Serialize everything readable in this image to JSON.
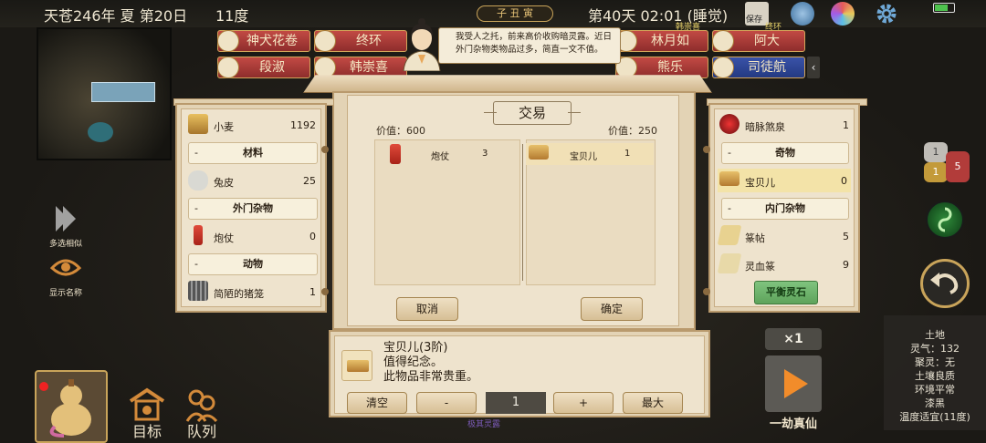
{
  "topbar": {
    "date": "天苍246年 夏 第20日",
    "temperature": "11度",
    "clock_badge": "子 丑 寅",
    "day_time": "第40天 02:01 (睡觉)",
    "save_label": "保存",
    "battery_level": 0.6
  },
  "npcs": [
    {
      "name": "神犬花卷",
      "style": "red"
    },
    {
      "name": "终环",
      "style": "red"
    },
    {
      "name": "段淑",
      "style": "red"
    },
    {
      "name": "韩崇喜",
      "style": "red"
    },
    {
      "name": "林月如",
      "style": "red"
    },
    {
      "name": "阿大",
      "style": "red"
    },
    {
      "name": "熊乐",
      "style": "red"
    },
    {
      "name": "司徒航",
      "style": "blue"
    }
  ],
  "npc_small_labels": [
    "韩崇喜",
    "终环"
  ],
  "speech": "我受人之托，前来高价收购暗灵露。近日外门杂物类物品过多，简直一文不值。",
  "trade": {
    "title": "交易",
    "left_price": "价值：600",
    "right_price": "价值：250",
    "left_items": [
      {
        "name": "炮仗",
        "count": "3"
      }
    ],
    "right_items": [
      {
        "name": "宝贝儿",
        "count": "1"
      }
    ],
    "cancel_label": "取消",
    "confirm_label": "确定"
  },
  "player_inventory": {
    "rows": [
      {
        "type": "item",
        "name": "小麦",
        "count": "1192",
        "icon": "wheat-icon"
      },
      {
        "type": "category",
        "name": "材料"
      },
      {
        "type": "item",
        "name": "兔皮",
        "count": "25",
        "icon": "rabbit-fur-icon"
      },
      {
        "type": "category",
        "name": "外门杂物"
      },
      {
        "type": "item",
        "name": "炮仗",
        "count": "0",
        "icon": "firecracker-icon"
      },
      {
        "type": "category",
        "name": "动物"
      },
      {
        "type": "item",
        "name": "简陋的猪笼",
        "count": "1",
        "icon": "pig-cage-icon"
      }
    ]
  },
  "merchant_inventory": {
    "rows": [
      {
        "type": "item",
        "name": "暗脉煞泉",
        "count": "1",
        "icon": "dark-spring-icon"
      },
      {
        "type": "category",
        "name": "奇物"
      },
      {
        "type": "item",
        "name": "宝贝儿",
        "count": "0",
        "icon": "treasure-icon",
        "highlight": true
      },
      {
        "type": "category",
        "name": "内门杂物"
      },
      {
        "type": "item",
        "name": "篆帖",
        "count": "5",
        "icon": "scroll-icon"
      },
      {
        "type": "item",
        "name": "灵血篆",
        "count": "9",
        "icon": "blood-talisman-icon"
      }
    ],
    "balance_label": "平衡灵石"
  },
  "detail": {
    "title": "宝贝儿(3阶)",
    "line1": "值得纪念。",
    "line2": "此物品非常贵重。",
    "clear_label": "清空",
    "minus_label": "-",
    "quantity": "1",
    "plus_label": "+",
    "max_label": "最大",
    "footer_hint": "极其灵露"
  },
  "left_tools": [
    {
      "label": "多选相似",
      "icon": "multi-select-icon"
    },
    {
      "label": "显示名称",
      "icon": "eye-icon"
    }
  ],
  "bottom_buttons": [
    {
      "label": "目标",
      "icon": "target-icon"
    },
    {
      "label": "队列",
      "icon": "queue-icon"
    }
  ],
  "right_side": {
    "pill_top": "1",
    "pill_mid": "1",
    "pill_red": "5",
    "speed_label": "×1",
    "play_label": "一劫真仙"
  },
  "tile_info": [
    "土地",
    "灵气：132",
    "聚灵：无",
    "土壤良质",
    "环境平常",
    "漆黑",
    "温度适宜(11度)"
  ],
  "colors": {
    "accent_red": "#b23c3a",
    "panel": "#eee3cd",
    "balance_green": "#6db56a",
    "play_orange": "#f28c2a"
  }
}
